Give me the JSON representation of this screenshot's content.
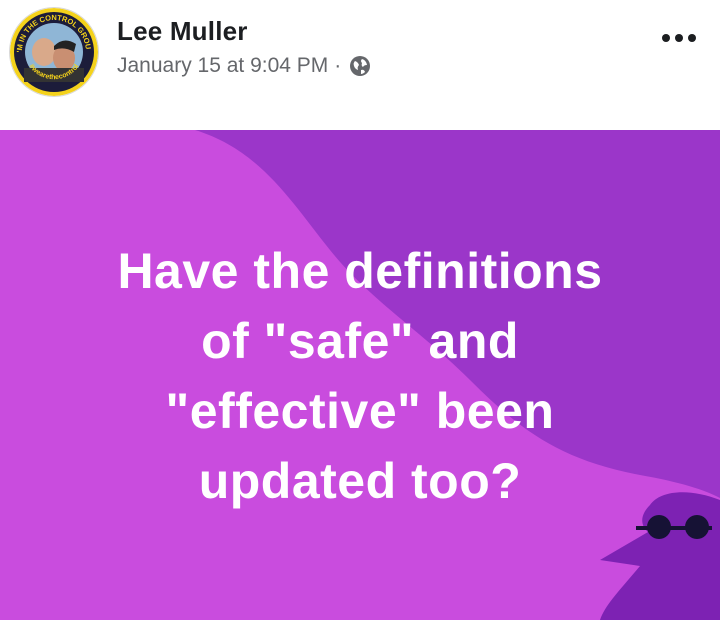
{
  "post": {
    "author_name": "Lee Muller",
    "timestamp": "January 15 at 9:04 PM",
    "separator": "·",
    "privacy_icon": "globe-icon",
    "more_icon": "more-options-icon",
    "avatar_badge_top_text": "I'M IN THE CONTROL GROUP",
    "avatar_badge_bottom_text": "#wearethecontrol",
    "text_lines": [
      "Have the definitions",
      "of \"safe\" and",
      "\"effective\" been",
      "updated too?"
    ]
  },
  "colors": {
    "background_magenta": "#c94cde",
    "background_purple": "#9b36c9",
    "silhouette_purple": "#7d22b3",
    "glasses": "#161235",
    "text": "#ffffff",
    "badge_yellow": "#f4d21b"
  }
}
